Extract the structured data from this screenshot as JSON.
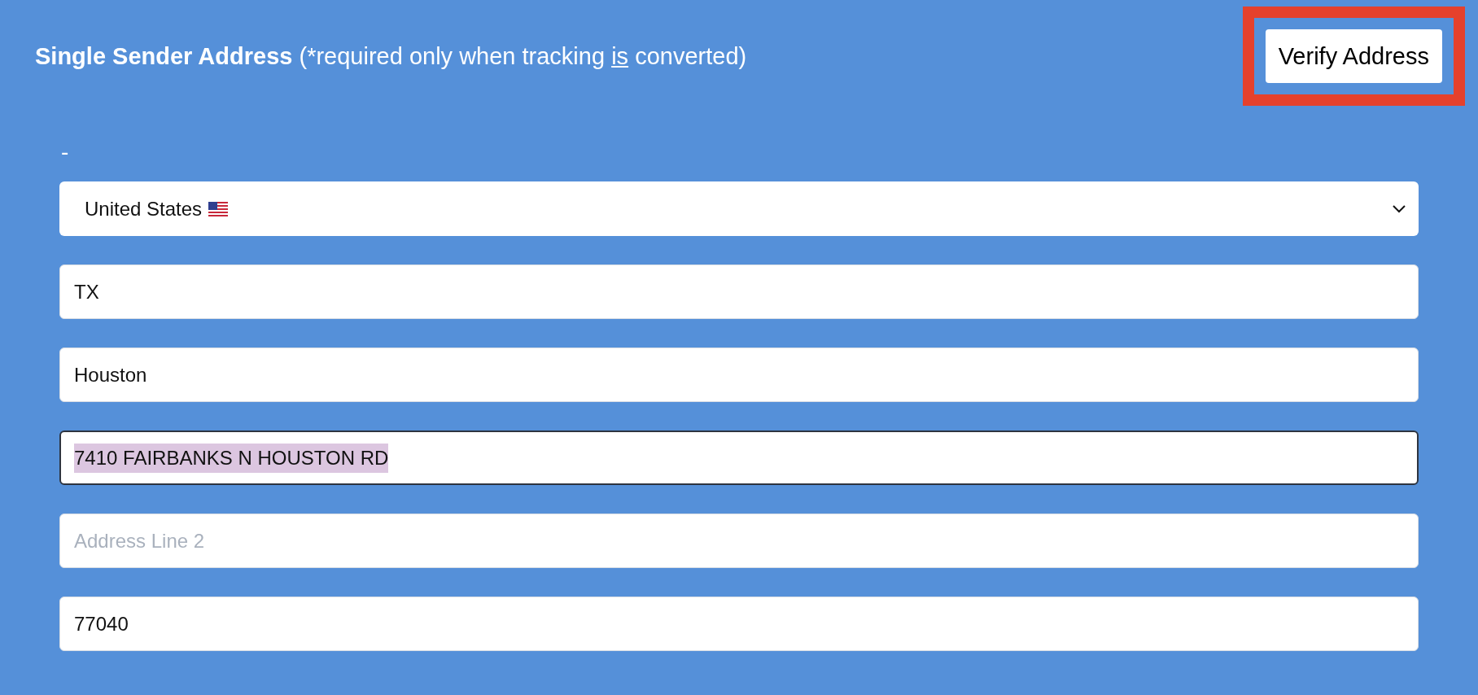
{
  "section": {
    "title": "Single Sender Address",
    "note": [
      {
        "text": "(*required only when tracking ",
        "underlined": false
      },
      {
        "text": "is",
        "underlined": true
      },
      {
        "text": " converted)",
        "underlined": false
      }
    ]
  },
  "verify_button": {
    "label": "Verify Address",
    "highlighted": true
  },
  "dash": "-",
  "country_select": {
    "value": "United States"
  },
  "fields": [
    {
      "value": "TX",
      "focused": false,
      "text_selected": false
    },
    {
      "value": "Houston",
      "focused": false,
      "text_selected": false
    },
    {
      "value": "7410 FAIRBANKS N HOUSTON RD",
      "focused": true,
      "text_selected": true
    },
    {
      "placeholder": "Address Line 2",
      "focused": false,
      "text_selected": false
    },
    {
      "value": "77040",
      "focused": false,
      "text_selected": false
    }
  ]
}
